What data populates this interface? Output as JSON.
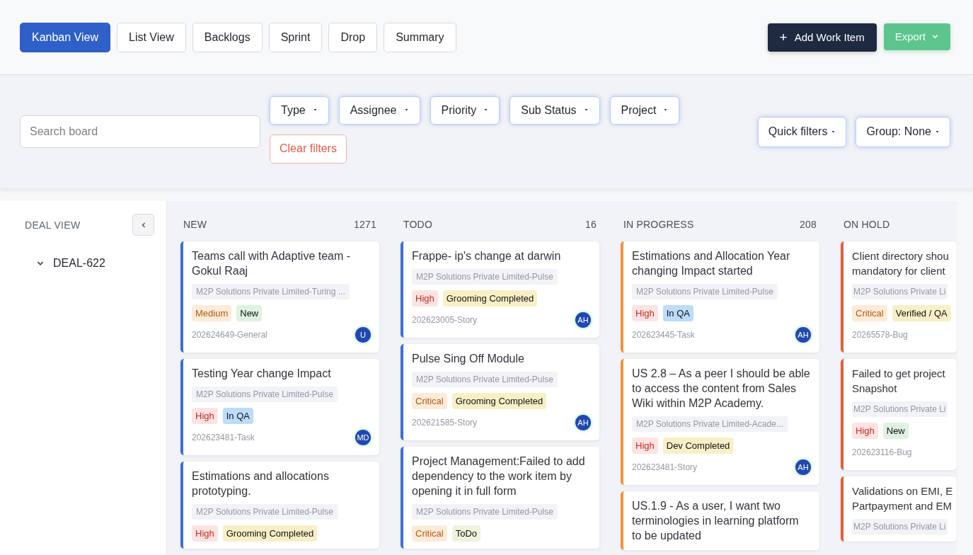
{
  "views": [
    {
      "label": "Kanban View",
      "selected": true
    },
    {
      "label": "List View",
      "selected": false
    },
    {
      "label": "Backlogs",
      "selected": false
    },
    {
      "label": "Sprint",
      "selected": false
    },
    {
      "label": "Drop",
      "selected": false
    },
    {
      "label": "Summary",
      "selected": false
    }
  ],
  "actions": {
    "add": {
      "icon": "+",
      "label": "Add Work Item"
    },
    "export": {
      "label": "Export"
    }
  },
  "search": {
    "placeholder": "Search board"
  },
  "filters": [
    "Type",
    "Assignee",
    "Priority",
    "Sub Status",
    "Project"
  ],
  "clear_filters": "Clear filters",
  "quick_filters": "Quick filters",
  "group": "Group: None",
  "sidebar": {
    "title": "DEAL VIEW",
    "items": [
      {
        "label": "DEAL-622",
        "expanded": true
      }
    ]
  },
  "columns": [
    {
      "name": "NEW",
      "count": "1271",
      "color": "#3b6fd8",
      "cards": [
        {
          "title": "Teams call with Adaptive team - Gokul Raaj",
          "project": "M2P Solutions Private Limited-Turing ...",
          "priority": {
            "label": "Medium",
            "kind": "medium"
          },
          "status": {
            "label": "New",
            "kind": "new"
          },
          "id": "202624649-General",
          "avatar": "U"
        },
        {
          "title": "Testing Year change Impact",
          "project": "M2P Solutions Private Limited-Pulse",
          "priority": {
            "label": "High",
            "kind": "high"
          },
          "status": {
            "label": "In QA",
            "kind": "qa"
          },
          "id": "202623481-Task",
          "avatar": "MD"
        },
        {
          "title": "Estimations and allocations prototyping.",
          "project": "M2P Solutions Private Limited-Pulse",
          "priority": {
            "label": "High",
            "kind": "high"
          },
          "status": {
            "label": "Grooming Completed",
            "kind": "done"
          }
        }
      ]
    },
    {
      "name": "TODO",
      "count": "16",
      "color": "#3b6fd8",
      "cards": [
        {
          "title": "Frappe- ip's change at darwin",
          "project": "M2P Solutions Private Limited-Pulse",
          "priority": {
            "label": "High",
            "kind": "high"
          },
          "status": {
            "label": "Grooming Completed",
            "kind": "done"
          },
          "id": "202623005-Story",
          "avatar": "AH"
        },
        {
          "title": "Pulse Sing Off Module",
          "project": "M2P Solutions Private Limited-Pulse",
          "priority": {
            "label": "Critical",
            "kind": "critical"
          },
          "status": {
            "label": "Grooming Completed",
            "kind": "done"
          },
          "id": "202621585-Story",
          "avatar": "AH"
        },
        {
          "title": "Project Management:Failed to add dependency to the work item by opening it in full form",
          "project": "M2P Solutions Private Limited-Pulse",
          "priority": {
            "label": "Critical",
            "kind": "critical"
          },
          "status": {
            "label": "ToDo",
            "kind": "todo"
          }
        }
      ]
    },
    {
      "name": "IN PROGRESS",
      "count": "208",
      "color": "#f0933a",
      "cards": [
        {
          "title": "Estimations and Allocation Year changing Impact started",
          "project": "M2P Solutions Private Limited-Pulse",
          "priority": {
            "label": "High",
            "kind": "high"
          },
          "status": {
            "label": "In QA",
            "kind": "qa"
          },
          "id": "202623445-Task",
          "avatar": "AH"
        },
        {
          "title": "US 2.8 – As a peer I should be able to access the content from Sales Wiki within M2P Academy.",
          "project": "M2P Solutions Private Limited-Acade...",
          "priority": {
            "label": "High",
            "kind": "high"
          },
          "status": {
            "label": "Dev Completed",
            "kind": "done"
          },
          "id": "202623481-Story",
          "avatar": "AH"
        },
        {
          "title": "US.1.9 - As a user, I want two terminologies in learning platform to be updated"
        }
      ]
    },
    {
      "name": "ON HOLD",
      "color": "#e0603e",
      "cards": [
        {
          "title": "Client directory shou\nmandatory for client",
          "project": "M2P Solutions Private Li",
          "priority": {
            "label": "Critical",
            "kind": "critical"
          },
          "status": {
            "label": "Verified / QA",
            "kind": "done"
          },
          "id": "20265578-Bug"
        },
        {
          "title": "Failed to get project\nSnapshot",
          "project": "M2P Solutions Private Li",
          "priority": {
            "label": "High",
            "kind": "high"
          },
          "status": {
            "label": "New",
            "kind": "new"
          },
          "id": "202623116-Bug"
        },
        {
          "title": "Validations on EMI, E\nPartpayment and EM",
          "project": "M2P Solutions Private Li"
        }
      ]
    }
  ]
}
